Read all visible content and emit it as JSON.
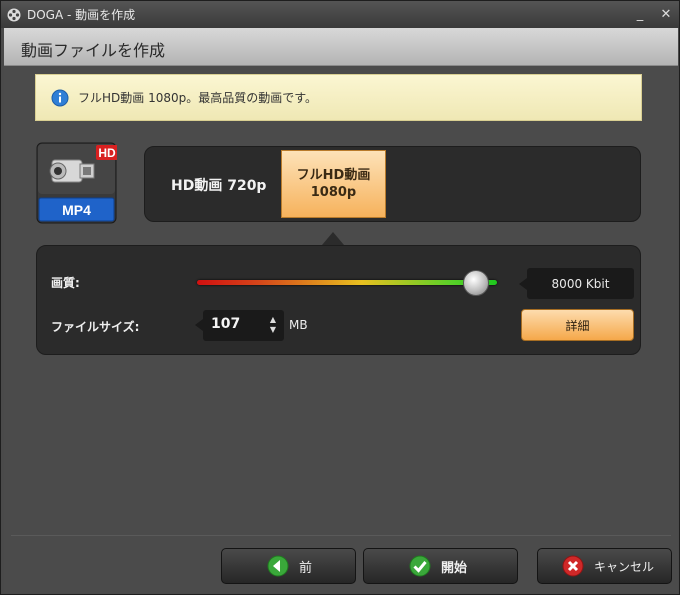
{
  "window": {
    "title": "DOGA - 動画を作成",
    "minimize_glyph": "_",
    "close_glyph": "✕"
  },
  "header": {
    "title": "動画ファイルを作成"
  },
  "info": {
    "icon": "info-icon",
    "text": "フルHD動画 1080p。最高品質の動画です。"
  },
  "format": {
    "badge": "HD",
    "container": "MP4",
    "options": [
      {
        "label": "HD動画 720p",
        "selected": false
      },
      {
        "label_line1": "フルHD動画",
        "label_line2": "1080p",
        "selected": true
      }
    ]
  },
  "quality": {
    "label": "画質:",
    "level": 0.93,
    "bitrate": "8000 Kbit"
  },
  "filesize": {
    "label": "ファイルサイズ:",
    "value": "107",
    "unit": "MB",
    "up_glyph": "▲",
    "down_glyph": "▼"
  },
  "detail_button": "詳細",
  "footer": {
    "prev": "前",
    "start": "開始",
    "cancel": "キャンセル"
  },
  "colors": {
    "accent_orange": "#f6b25c",
    "info_bg": "#fbf6d2",
    "mp4_blue": "#1f63c9",
    "hd_red": "#d82020",
    "ok_green": "#3aa83a",
    "cancel_red": "#d02828"
  }
}
